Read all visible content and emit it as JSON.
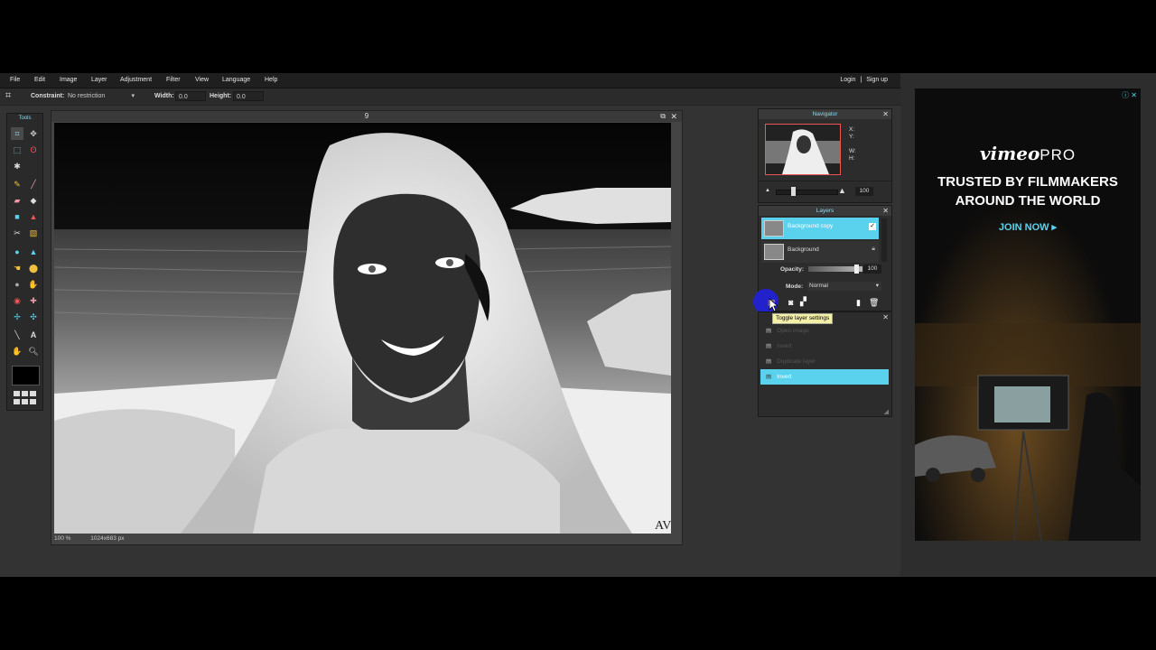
{
  "menu": [
    "File",
    "Edit",
    "Image",
    "Layer",
    "Adjustment",
    "Filter",
    "View",
    "Language",
    "Help"
  ],
  "auth": {
    "login": "Login",
    "separator": "|",
    "signup": "Sign up"
  },
  "options": {
    "constraint_label": "Constraint:",
    "constraint_value": "No restriction",
    "width_label": "Width:",
    "width_value": "0.0",
    "height_label": "Height:",
    "height_value": "0.0"
  },
  "tools": {
    "title": "Tools"
  },
  "document": {
    "title": "9",
    "zoom": "100",
    "zoom_unit": "%",
    "size": "1024x683 px",
    "watermark": "AV"
  },
  "navigator": {
    "title": "Navigator",
    "x_label": "X:",
    "y_label": "Y:",
    "w_label": "W:",
    "h_label": "H:",
    "zoom_value": "100"
  },
  "layers": {
    "title": "Layers",
    "items": [
      {
        "name": "Background copy",
        "selected": true
      },
      {
        "name": "Background",
        "selected": false
      }
    ],
    "opacity_label": "Opacity:",
    "opacity_value": "100",
    "opacity_fraction": 1.0,
    "mode_label": "Mode:",
    "mode_value": "Normal",
    "tooltip": "Toggle layer settings"
  },
  "history": {
    "items": [
      {
        "label": "Open image",
        "active": false
      },
      {
        "label": "Invert",
        "active": false
      },
      {
        "label": "Duplicate layer",
        "active": false
      },
      {
        "label": "Invert",
        "active": true
      }
    ]
  },
  "ad": {
    "brand": "vimeo",
    "brand_suffix": "PRO",
    "headline_line1": "TRUSTED BY FILMMAKERS",
    "headline_line2": "AROUND THE WORLD",
    "cta": "JOIN NOW ▸"
  },
  "colors": {
    "accent": "#5ad2ee",
    "panel": "#2c2c2c",
    "app_bg": "#333333",
    "highlight": "#2222cc"
  }
}
